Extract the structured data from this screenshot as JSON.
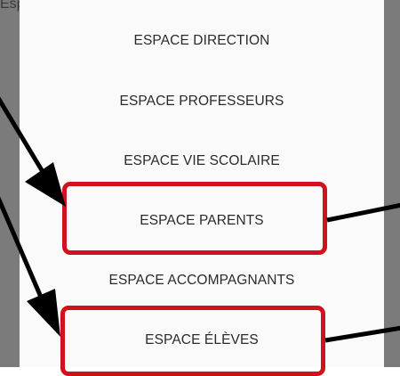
{
  "backdrop": {
    "partial_text": "Esp"
  },
  "menu": {
    "items": [
      {
        "label": "ESPACE DIRECTION"
      },
      {
        "label": "ESPACE PROFESSEURS"
      },
      {
        "label": "ESPACE VIE SCOLAIRE"
      },
      {
        "label": "ESPACE PARENTS",
        "highlighted": true
      },
      {
        "label": "ESPACE ACCOMPAGNANTS"
      },
      {
        "label": "ESPACE ÉLÈVES",
        "highlighted": true
      }
    ]
  },
  "colors": {
    "highlight": "#d0121c",
    "arrow": "#000000",
    "backdrop": "#7b7b7b",
    "modal": "#fafafa"
  }
}
